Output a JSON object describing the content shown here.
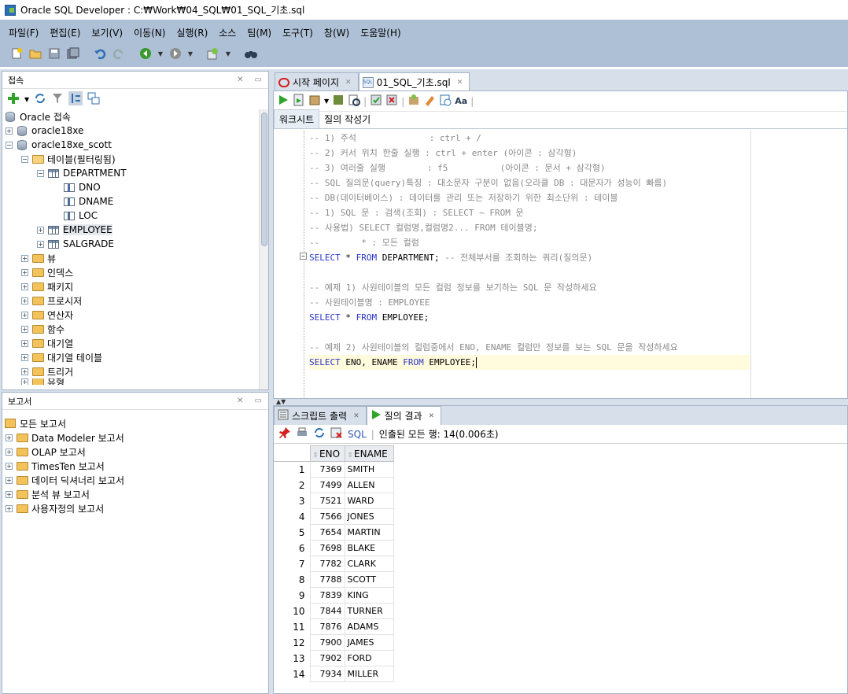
{
  "window": {
    "title": "Oracle SQL Developer : C:₩Work₩04_SQL₩01_SQL_기초.sql"
  },
  "menu": [
    "파일(F)",
    "편집(E)",
    "보기(V)",
    "이동(N)",
    "실행(R)",
    "소스",
    "팀(M)",
    "도구(T)",
    "창(W)",
    "도움말(H)"
  ],
  "connections": {
    "title": "접속",
    "items": [
      {
        "label": "Oracle 접속"
      },
      {
        "label": "oracle18xe"
      },
      {
        "label": "oracle18xe_scott"
      },
      {
        "label": "테이블(필터링됨)"
      },
      {
        "label": "DEPARTMENT"
      },
      {
        "label": "DNO"
      },
      {
        "label": "DNAME"
      },
      {
        "label": "LOC"
      },
      {
        "label": "EMPLOYEE"
      },
      {
        "label": "SALGRADE"
      },
      {
        "label": "뷰"
      },
      {
        "label": "인덱스"
      },
      {
        "label": "패키지"
      },
      {
        "label": "프로시저"
      },
      {
        "label": "연산자"
      },
      {
        "label": "함수"
      },
      {
        "label": "대기열"
      },
      {
        "label": "대기열 테이블"
      },
      {
        "label": "트리거"
      },
      {
        "label": "유형"
      }
    ]
  },
  "reports": {
    "title": "보고서",
    "items": [
      {
        "label": "모든 보고서"
      },
      {
        "label": "Data Modeler 보고서"
      },
      {
        "label": "OLAP 보고서"
      },
      {
        "label": "TimesTen 보고서"
      },
      {
        "label": "데이터 딕셔너리 보고서"
      },
      {
        "label": "분석 뷰 보고서"
      },
      {
        "label": "사용자정의 보고서"
      }
    ]
  },
  "doc_tabs": [
    {
      "label": "시작 페이지"
    },
    {
      "label": "01_SQL_기초.sql"
    }
  ],
  "editor_tabs": {
    "worksheet": "워크시트",
    "query_builder": "질의 작성기"
  },
  "code_lines": [
    "-- 1) 주석              : ctrl + /",
    "-- 2) 커서 위치 한줄 실행 : ctrl + enter (아이콘 : 삼각형)",
    "-- 3) 여러줄 실행        : f5          (아이콘 : 문서 + 삼각형)",
    "-- SQL 질의문(query)특징 : 대소문자 구분이 없음(오라클 DB : 대문자가 성능이 빠름)",
    "-- DB(데이터베이스) : 데이터를 관리 또는 저장하기 위한 최소단위 : 테이블",
    "-- 1) SQL 문 : 검색(조회) : SELECT ~ FROM 문",
    "-- 사용법) SELECT 컬럼명,컬럼명2... FROM 테이블명;",
    "--        * : 모든 컬럼",
    "SELECT * FROM DEPARTMENT; -- 전체부서를 조회하는 쿼리(질의문)",
    "",
    "-- 예제 1) 사원테이블의 모든 컬럼 정보를 보기하는 SQL 문 작성하세요",
    "-- 사원테이블명 : EMPLOYEE",
    "SELECT * FROM EMPLOYEE;",
    "",
    "-- 예제 2) 사원테이블의 컬럼중에서 ENO, ENAME 컬럼만 정보를 보는 SQL 문을 작성하세요",
    "SELECT ENO, ENAME FROM EMPLOYEE;"
  ],
  "result_tabs": [
    {
      "label": "스크립트 출력"
    },
    {
      "label": "질의 결과"
    }
  ],
  "result_toolbar": {
    "sql": "SQL",
    "status": "인출된 모든 행: 14(0.006초)"
  },
  "result_grid": {
    "columns": [
      "ENO",
      "ENAME"
    ],
    "rows": [
      {
        "n": "1",
        "eno": "7369",
        "ename": "SMITH"
      },
      {
        "n": "2",
        "eno": "7499",
        "ename": "ALLEN"
      },
      {
        "n": "3",
        "eno": "7521",
        "ename": "WARD"
      },
      {
        "n": "4",
        "eno": "7566",
        "ename": "JONES"
      },
      {
        "n": "5",
        "eno": "7654",
        "ename": "MARTIN"
      },
      {
        "n": "6",
        "eno": "7698",
        "ename": "BLAKE"
      },
      {
        "n": "7",
        "eno": "7782",
        "ename": "CLARK"
      },
      {
        "n": "8",
        "eno": "7788",
        "ename": "SCOTT"
      },
      {
        "n": "9",
        "eno": "7839",
        "ename": "KING"
      },
      {
        "n": "10",
        "eno": "7844",
        "ename": "TURNER"
      },
      {
        "n": "11",
        "eno": "7876",
        "ename": "ADAMS"
      },
      {
        "n": "12",
        "eno": "7900",
        "ename": "JAMES"
      },
      {
        "n": "13",
        "eno": "7902",
        "ename": "FORD"
      },
      {
        "n": "14",
        "eno": "7934",
        "ename": "MILLER"
      }
    ]
  },
  "colors": {
    "chrome": "#aec0d6",
    "panel_bg": "#d7e0ea",
    "keyword": "#2a35c9",
    "comment": "#8a8a8a",
    "current_line": "#fffbdc"
  }
}
